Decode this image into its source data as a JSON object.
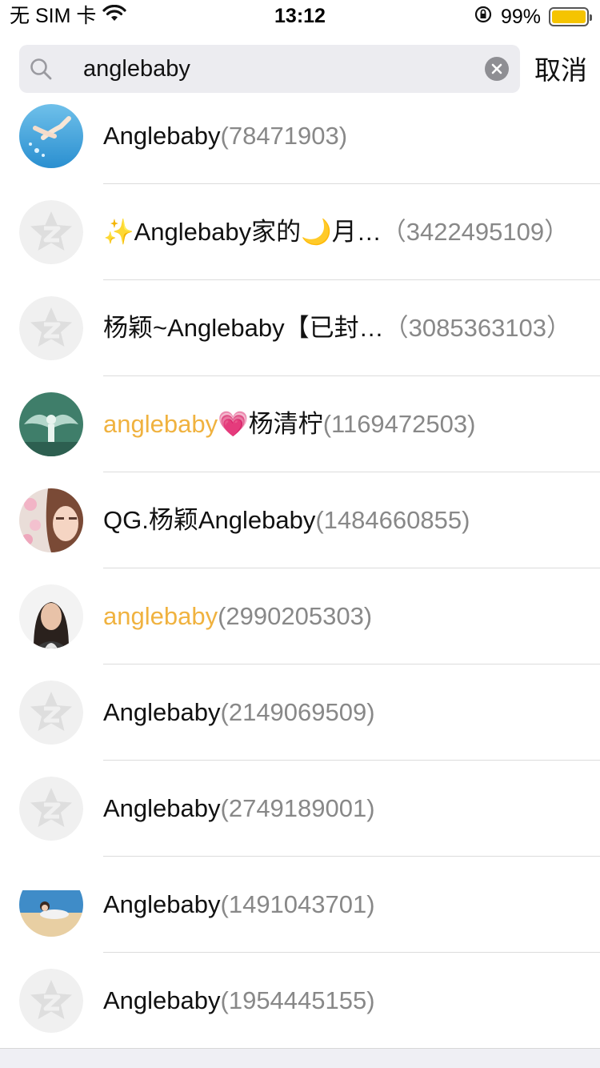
{
  "status_bar": {
    "carrier": "无 SIM 卡",
    "time": "13:12",
    "battery_percent": "99%",
    "battery_level": 0.99,
    "battery_color": "#f5c400"
  },
  "search": {
    "query": "anglebaby",
    "cancel_label": "取消"
  },
  "highlight_color": "#f0b23f",
  "results": [
    {
      "name": "Anglebaby",
      "highlight": false,
      "qq": "(78471903)",
      "avatar": "hands-sky-photo"
    },
    {
      "name": "✨Anglebaby家的🌙月…",
      "highlight": false,
      "qq": "（3422495109）",
      "avatar": "default-qq-avatar"
    },
    {
      "name": "杨颖~Anglebaby【已封…",
      "highlight": false,
      "qq": "（3085363103）",
      "avatar": "default-qq-avatar"
    },
    {
      "name": "anglebaby",
      "name_suffix": "💗杨清柠",
      "highlight": true,
      "qq": "(1169472503)",
      "avatar": "green-wings-photo"
    },
    {
      "name": "QG.杨颖Anglebaby",
      "highlight": false,
      "qq": "(1484660855)",
      "avatar": "girl-flowers-photo"
    },
    {
      "name": "anglebaby",
      "highlight": true,
      "qq": "(2990205303)",
      "avatar": "woman-portrait-photo"
    },
    {
      "name": "Anglebaby",
      "highlight": false,
      "qq": "(2149069509)",
      "avatar": "default-qq-avatar"
    },
    {
      "name": "Anglebaby",
      "highlight": false,
      "qq": "(2749189001)",
      "avatar": "default-qq-avatar"
    },
    {
      "name": "Anglebaby",
      "highlight": false,
      "qq": "(1491043701)",
      "avatar": "beach-photo"
    },
    {
      "name": "Anglebaby",
      "highlight": false,
      "qq": "(1954445155)",
      "avatar": "default-qq-avatar"
    }
  ]
}
